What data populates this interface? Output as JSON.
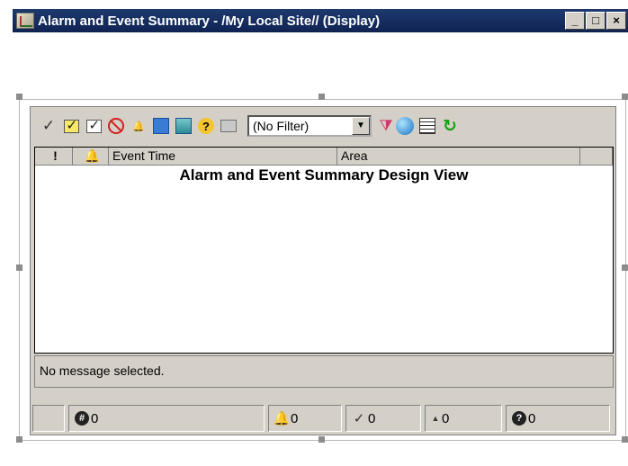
{
  "window": {
    "title": "Alarm and Event Summary - /My Local Site// (Display)",
    "buttons": {
      "minimize": "_",
      "maximize": "□",
      "close": "×"
    }
  },
  "toolbar": {
    "filter_value": "(No Filter)",
    "icons": [
      "acknowledge",
      "acknowledge-page",
      "acknowledge-selected",
      "disable",
      "silence",
      "details",
      "properties",
      "help",
      "print",
      "filter",
      "find",
      "columns",
      "refresh"
    ]
  },
  "grid": {
    "columns": [
      "!",
      "",
      "Event Time",
      "Area",
      ""
    ],
    "design_view_label": "Alarm and Event Summary Design View"
  },
  "message_bar": {
    "text": "No message selected."
  },
  "status": {
    "total_count": "0",
    "alarm_count": "0",
    "ack_count": "0",
    "minor_count": "0",
    "unknown_count": "0"
  }
}
